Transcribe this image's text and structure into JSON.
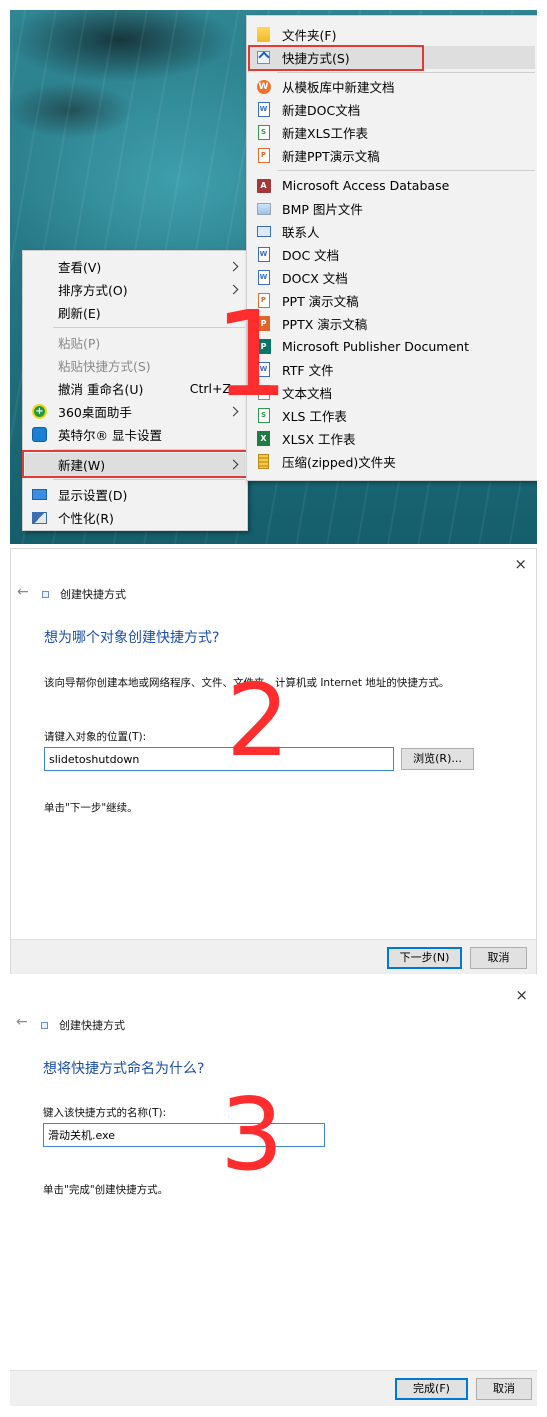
{
  "step_numbers": [
    "1",
    "2",
    "3"
  ],
  "context_menu": {
    "items": [
      {
        "label": "查看(V)",
        "submenu": true
      },
      {
        "label": "排序方式(O)",
        "submenu": true
      },
      {
        "label": "刷新(E)"
      },
      {
        "label": "粘贴(P)",
        "disabled": true
      },
      {
        "label": "粘贴快捷方式(S)",
        "disabled": true
      },
      {
        "label": "撤消 重命名(U)",
        "shortcut": "Ctrl+Z"
      },
      {
        "label": "360桌面助手",
        "icon": "360-icon",
        "submenu": true
      },
      {
        "label": "英特尔® 显卡设置",
        "icon": "intel-graphics-icon"
      },
      {
        "label": "新建(W)",
        "submenu": true,
        "highlighted": true
      },
      {
        "label": "显示设置(D)",
        "icon": "display-settings-icon"
      },
      {
        "label": "个性化(R)",
        "icon": "personalize-icon"
      }
    ]
  },
  "new_submenu": {
    "items": [
      {
        "label": "文件夹(F)",
        "icon": "folder-icon"
      },
      {
        "label": "快捷方式(S)",
        "icon": "shortcut-icon",
        "highlighted": true
      },
      {
        "label": "从模板库中新建文档",
        "icon": "wps-template-icon"
      },
      {
        "label": "新建DOC文档",
        "icon": "wps-doc-icon"
      },
      {
        "label": "新建XLS工作表",
        "icon": "wps-xls-icon"
      },
      {
        "label": "新建PPT演示文稿",
        "icon": "wps-ppt-icon"
      },
      {
        "label": "Microsoft Access Database",
        "icon": "access-icon"
      },
      {
        "label": "BMP 图片文件",
        "icon": "bmp-icon"
      },
      {
        "label": "联系人",
        "icon": "contact-icon"
      },
      {
        "label": "DOC 文档",
        "icon": "doc-icon"
      },
      {
        "label": "DOCX 文档",
        "icon": "docx-icon"
      },
      {
        "label": "PPT 演示文稿",
        "icon": "ppt-icon"
      },
      {
        "label": "PPTX 演示文稿",
        "icon": "pptx-icon"
      },
      {
        "label": "Microsoft Publisher Document",
        "icon": "publisher-icon"
      },
      {
        "label": "RTF 文件",
        "icon": "rtf-icon"
      },
      {
        "label": "文本文档",
        "icon": "text-document-icon"
      },
      {
        "label": "XLS 工作表",
        "icon": "xls-icon"
      },
      {
        "label": "XLSX 工作表",
        "icon": "xlsx-icon"
      },
      {
        "label": "压缩(zipped)文件夹",
        "icon": "zip-folder-icon"
      }
    ]
  },
  "wizard_step1": {
    "title": "创建快捷方式",
    "heading": "想为哪个对象创建快捷方式?",
    "description": "该向导帮你创建本地或网络程序、文件、文件夹、计算机或 Internet 地址的快捷方式。",
    "location_label": "请键入对象的位置(T):",
    "location_value": "slidetoshutdown",
    "browse_label": "浏览(R)...",
    "hint": "单击\"下一步\"继续。",
    "next_label": "下一步(N)",
    "cancel_label": "取消",
    "close_glyph": "×",
    "back_glyph": "←"
  },
  "wizard_step2": {
    "title": "创建快捷方式",
    "heading": "想将快捷方式命名为什么?",
    "name_label": "键入该快捷方式的名称(T):",
    "name_value": "滑动关机.exe",
    "hint": "单击\"完成\"创建快捷方式。",
    "finish_label": "完成(F)",
    "cancel_label": "取消",
    "close_glyph": "×",
    "back_glyph": "←"
  },
  "colors": {
    "step_number": "#ff2d2d",
    "highlight_frame": "#e53935",
    "heading_blue": "#1b4fa6",
    "input_border": "#3c84d6"
  }
}
